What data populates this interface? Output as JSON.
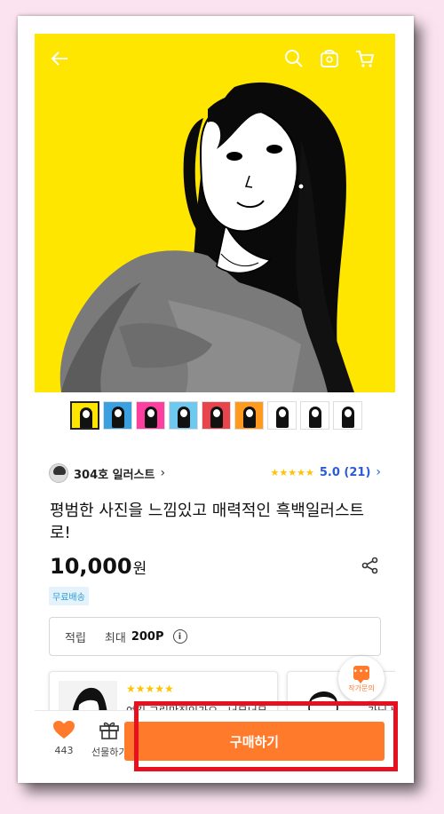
{
  "hero": {
    "background_color": "#ffe600",
    "icons": [
      "back-arrow-icon",
      "search-icon",
      "store-icon",
      "cart-icon"
    ]
  },
  "thumbnails": [
    {
      "bg": "#ffe600"
    },
    {
      "bg": "#3aa0e0"
    },
    {
      "bg": "#ff3fa0"
    },
    {
      "bg": "#6ec8ef"
    },
    {
      "bg": "#e8444d"
    },
    {
      "bg": "#ff9a1f"
    },
    {
      "bg": "#ffffff"
    },
    {
      "bg": "#ffffff"
    },
    {
      "bg": "#ffffff"
    }
  ],
  "seller": {
    "name": "304호 일러스트",
    "chevron": "›"
  },
  "rating": {
    "stars": "★★★★★",
    "text": "5.0 (21)",
    "chevron": "›"
  },
  "product": {
    "title": "평범한 사진을 느낌있고 매력적인 흑백일러스트로!",
    "price": "10,000",
    "currency": "원",
    "shipping_badge": "무료배송"
  },
  "points": {
    "label": "적립",
    "max_label": "최대",
    "value": "200P",
    "info": "i"
  },
  "reviews": [
    {
      "stars": "★★★★★",
      "text": "여긴 그림맛집인가요.. 너무너무 마음에 들어요 예뻐게 정"
    },
    {
      "stars": "",
      "text": "가님 배경도"
    }
  ],
  "chat_fab": {
    "label": "작가문의",
    "dots": "•••"
  },
  "bottom_bar": {
    "like_count": "443",
    "gift_label": "선물하기",
    "buy_label": "구매하기"
  },
  "colors": {
    "accent": "#ff7a2b",
    "link": "#2a5bd7",
    "star": "#ffc400",
    "highlight": "#e8101e"
  }
}
